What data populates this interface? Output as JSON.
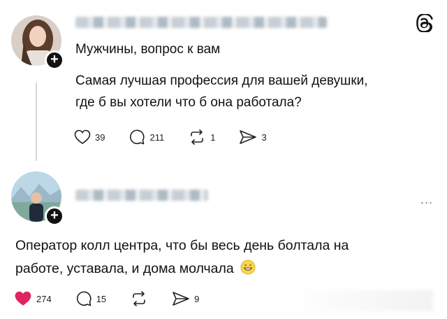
{
  "colors": {
    "accent_like": "#e0245e",
    "text": "#111111",
    "muted": "#777777"
  },
  "post1": {
    "subtitle": "Мужчины, вопрос к вам",
    "body_line1": "Самая лучшая профессия для вашей девушки,",
    "body_line2": "где б вы хотели что б она работала?",
    "likes": "39",
    "replies": "211",
    "reposts": "1",
    "shares": "3",
    "icons": [
      "heart-outline-icon",
      "comment-icon",
      "repost-icon",
      "share-icon",
      "threads-logo-icon",
      "plus-icon"
    ]
  },
  "post2": {
    "body_line1": "Оператор колл центра, что бы весь день болтала на",
    "body_line2": "работе, уставала, и дома молчала",
    "likes": "274",
    "replies": "15",
    "shares": "9",
    "more": "...",
    "icons": [
      "heart-filled-icon",
      "comment-icon",
      "repost-icon",
      "share-icon",
      "grinning-emoji-icon",
      "more-icon",
      "plus-icon"
    ]
  }
}
